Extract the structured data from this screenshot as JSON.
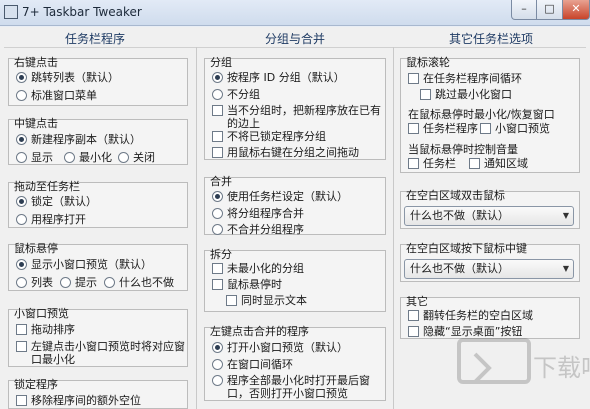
{
  "window": {
    "title": "7+ Taskbar Tweaker"
  },
  "columns": {
    "left_title": "任务栏程序",
    "middle_title": "分组与合并",
    "right_title": "其它任务栏选项"
  },
  "left": {
    "right_click": {
      "label": "右键点击",
      "opt1": "跳转列表（默认）",
      "opt2": "标准窗口菜单",
      "selected": 1
    },
    "middle_click": {
      "label": "中键点击",
      "opt1": "新建程序副本（默认）",
      "opt2": "显示",
      "opt3": "最小化",
      "opt4": "关闭",
      "selected": 1
    },
    "drag": {
      "label": "拖动至任务栏",
      "opt1": "锁定（默认）",
      "opt2": "用程序打开",
      "selected": 1
    },
    "hover": {
      "label": "鼠标悬停",
      "opt1": "显示小窗口预览（默认）",
      "opt2": "列表",
      "opt3": "提示",
      "opt4": "什么也不做",
      "selected": 1
    },
    "thumbnail": {
      "label": "小窗口预览",
      "opt1": "拖动排序",
      "opt2": "左键点击小窗口预览时将对应窗口最小化"
    },
    "pinned": {
      "label": "锁定程序",
      "opt1": "移除程序间的额外空位"
    }
  },
  "middle": {
    "grouping": {
      "label": "分组",
      "opt1": "按程序 ID 分组（默认）",
      "opt2": "不分组",
      "opt3": "当不分组时，把新程序放在已有的边上",
      "opt4": "不将已锁定程序分组",
      "opt5": "用鼠标右键在分组之间拖动",
      "selected": 1
    },
    "combining": {
      "label": "合并",
      "opt1": "使用任务栏设定（默认）",
      "opt2": "将分组程序合并",
      "opt3": "不合并分组程序",
      "selected": 1
    },
    "decombine": {
      "label": "拆分",
      "opt1": "未最小化的分组",
      "opt2": "鼠标悬停时",
      "opt3": "同时显示文本"
    },
    "left_click_combined": {
      "label": "左键点击合并的程序",
      "opt1": "打开小窗口预览（默认）",
      "opt2": "在窗口间循环",
      "opt3": "程序全部最小化时打开最后窗口，否则打开小窗口预览",
      "selected": 1
    }
  },
  "right": {
    "wheel": {
      "label": "鼠标滚轮",
      "opt1": "在任务栏程序间循环",
      "opt2": "跳过最小化窗口",
      "sub_label": "在鼠标悬停时最小化/恢复窗口",
      "opt3": "任务栏程序",
      "opt4": "小窗口预览",
      "sub_label2": "当鼠标悬停时控制音量",
      "opt5": "任务栏",
      "opt6": "通知区域"
    },
    "double_click": {
      "label": "在空白区域双击鼠标",
      "value": "什么也不做（默认）"
    },
    "middle_click": {
      "label": "在空白区域按下鼠标中键",
      "value": "什么也不做（默认）"
    },
    "other": {
      "label": "其它",
      "opt1": "翻转任务栏的空白区域",
      "opt2": "隐藏“显示桌面”按钮"
    }
  },
  "watermark": {
    "text": "下载吧"
  }
}
